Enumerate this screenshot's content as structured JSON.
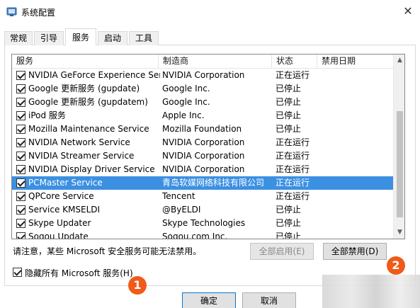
{
  "window": {
    "title": "系统配置",
    "close_glyph": "✕"
  },
  "tabs": [
    {
      "label": "常规"
    },
    {
      "label": "引导"
    },
    {
      "label": "服务",
      "active": true
    },
    {
      "label": "启动"
    },
    {
      "label": "工具"
    }
  ],
  "columns": {
    "name": "服务",
    "vendor": "制造商",
    "status": "状态",
    "date": "禁用日期"
  },
  "services": [
    {
      "name": "NVIDIA GeForce Experience Serv...",
      "vendor": "NVIDIA Corporation",
      "status": "正在运行",
      "date": "",
      "checked": true
    },
    {
      "name": "Google 更新服务 (gupdate)",
      "vendor": "Google Inc.",
      "status": "已停止",
      "date": "",
      "checked": true
    },
    {
      "name": "Google 更新服务 (gupdatem)",
      "vendor": "Google Inc.",
      "status": "已停止",
      "date": "",
      "checked": true
    },
    {
      "name": "iPod 服务",
      "vendor": "Apple Inc.",
      "status": "已停止",
      "date": "",
      "checked": true
    },
    {
      "name": "Mozilla Maintenance Service",
      "vendor": "Mozilla Foundation",
      "status": "已停止",
      "date": "",
      "checked": true
    },
    {
      "name": "NVIDIA Network Service",
      "vendor": "NVIDIA Corporation",
      "status": "正在运行",
      "date": "",
      "checked": true
    },
    {
      "name": "NVIDIA Streamer Service",
      "vendor": "NVIDIA Corporation",
      "status": "正在运行",
      "date": "",
      "checked": true
    },
    {
      "name": "NVIDIA Display Driver Service",
      "vendor": "NVIDIA Corporation",
      "status": "正在运行",
      "date": "",
      "checked": true
    },
    {
      "name": "PCMaster Service",
      "vendor": "青岛软媒网络科技有限公司",
      "status": "正在运行",
      "date": "",
      "checked": true,
      "selected": true
    },
    {
      "name": "QPCore Service",
      "vendor": "Tencent",
      "status": "正在运行",
      "date": "",
      "checked": true
    },
    {
      "name": "Service KMSELDI",
      "vendor": "@ByELDI",
      "status": "已停止",
      "date": "",
      "checked": true
    },
    {
      "name": "Skype Updater",
      "vendor": "Skype Technologies",
      "status": "已停止",
      "date": "",
      "checked": true
    },
    {
      "name": "Sogou Update",
      "vendor": "Sogou.com Inc.",
      "status": "已停止",
      "date": "",
      "checked": true
    }
  ],
  "scroll": {
    "up_glyph": "▲",
    "down_glyph": "▼"
  },
  "note": "请注意，某些 Microsoft 安全服务可能无法禁用。",
  "buttons": {
    "enable_all": "全部启用(E)",
    "disable_all": "全部禁用(D)",
    "ok": "确定",
    "cancel": "取消"
  },
  "hide_ms": {
    "label": "隐藏所有 Microsoft 服务(H)",
    "checked": true
  },
  "annotations": {
    "badge1": "1",
    "badge2": "2",
    "color": "#f05a1a"
  }
}
